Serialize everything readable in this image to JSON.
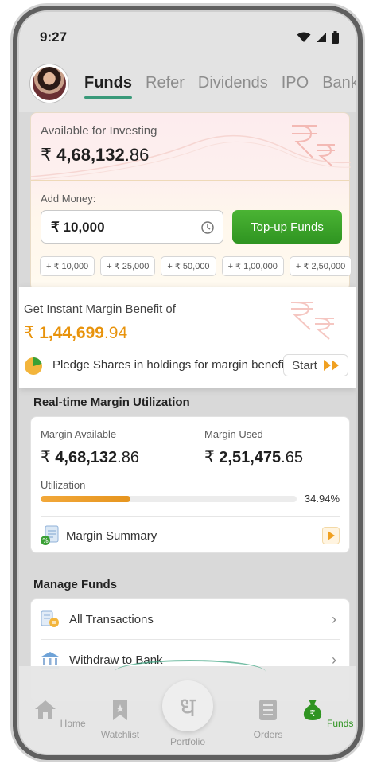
{
  "status": {
    "time": "9:27",
    "icons": [
      "wifi-icon",
      "signal-icon",
      "battery-icon"
    ]
  },
  "tabs": [
    {
      "label": "Funds",
      "active": true
    },
    {
      "label": "Refer",
      "active": false
    },
    {
      "label": "Dividends",
      "active": false
    },
    {
      "label": "IPO",
      "active": false
    },
    {
      "label": "Banks",
      "active": false
    }
  ],
  "invest": {
    "label": "Available for Investing",
    "currency": "₹",
    "amount_main": "4,68,132",
    "amount_decimal": ".86",
    "add_money_label": "Add Money:",
    "input_value": "₹ 10,000",
    "topup_label": "Top-up Funds",
    "chips": [
      "+ ₹ 10,000",
      "+ ₹ 25,000",
      "+ ₹ 50,000",
      "+ ₹ 1,00,000",
      "+ ₹ 2,50,000"
    ]
  },
  "banner": {
    "title": "Get Instant Margin Benefit of",
    "currency": "₹",
    "amount_main": "1,44,699",
    "amount_decimal": ".94",
    "pledge_text": "Pledge Shares in holdings for margin benefits.",
    "start_label": "Start"
  },
  "margin": {
    "section_title": "Real-time Margin Utilization",
    "available_label": "Margin Available",
    "available_main": "4,68,132",
    "available_decimal": ".86",
    "used_label": "Margin Used",
    "used_main": "2,51,475",
    "used_decimal": ".65",
    "currency": "₹",
    "utilization_label": "Utilization",
    "utilization_value": "34.94%",
    "utilization_fraction": 0.3494,
    "summary_label": "Margin Summary"
  },
  "manage": {
    "section_title": "Manage Funds",
    "rows": [
      {
        "label": "All Transactions",
        "icon": "transactions-icon"
      },
      {
        "label": "Withdraw to Bank",
        "icon": "bank-icon"
      }
    ]
  },
  "bottom_nav": [
    {
      "label": "Home",
      "icon": "home-icon",
      "active": false
    },
    {
      "label": "Watchlist",
      "icon": "bookmark-icon",
      "active": false
    },
    {
      "label": "Portfolio",
      "icon": "portfolio-icon",
      "active": false
    },
    {
      "label": "Orders",
      "icon": "orders-icon",
      "active": false
    },
    {
      "label": "Funds",
      "icon": "money-bag-icon",
      "active": true
    }
  ],
  "colors": {
    "accent_green": "#2f9421",
    "tab_underline": "#3a9a7a",
    "margin_orange": "#e8930c",
    "progress_fill": "#e6951f"
  }
}
